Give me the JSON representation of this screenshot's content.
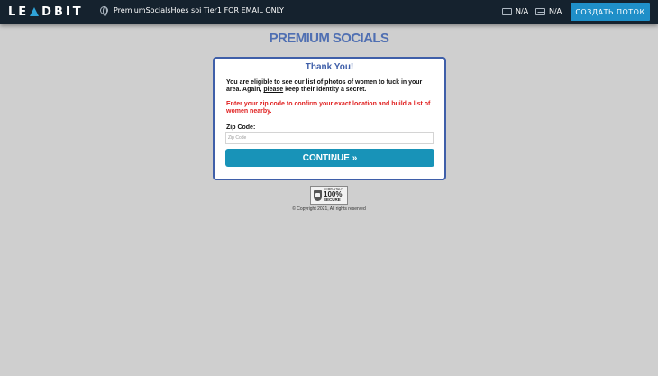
{
  "topbar": {
    "logo_left": "LE",
    "logo_right": "DBIT",
    "flow_name": "PremiumSocialsHoes soi Tier1 FOR EMAIL ONLY",
    "stat1_value": "N/A",
    "stat2_value": "N/A",
    "create_button_label": "СОЗДАТЬ ПОТОК"
  },
  "page": {
    "brand_title": "PREMIUM SOCIALS"
  },
  "card": {
    "title": "Thank You!",
    "desc_part1": "You are eligible to see our list of photos of women to fuck in your area. Again, ",
    "desc_please": "please",
    "desc_part2": " keep their identity a secret.",
    "warning": "Enter your zip code to confirm your exact location and build a list of women nearby.",
    "zip_label": "Zip Code:",
    "zip_placeholder": "Zip Code",
    "zip_value": "",
    "continue_label": "CONTINUE »"
  },
  "footer": {
    "secure_small": "COMPLETELY",
    "secure_big": "100%",
    "secure_mid": "SECURE",
    "copyright": "© Copyright 2021, All rights reserved"
  },
  "colors": {
    "topbar_bg": "#15222e",
    "accent_blue": "#1f8fc8",
    "brand_blue": "#4f6fb2",
    "card_border": "#3f5fa9",
    "warning_red": "#e02020",
    "continue_bg": "#1893b8",
    "page_bg": "#cfcfcf"
  },
  "icons": {
    "logo_mark": "triangle-a-icon",
    "flow_icon": "globe-icon",
    "stat1_icon": "card-icon",
    "stat2_icon": "mail-icon",
    "badge_icon": "shield-lock-icon"
  }
}
